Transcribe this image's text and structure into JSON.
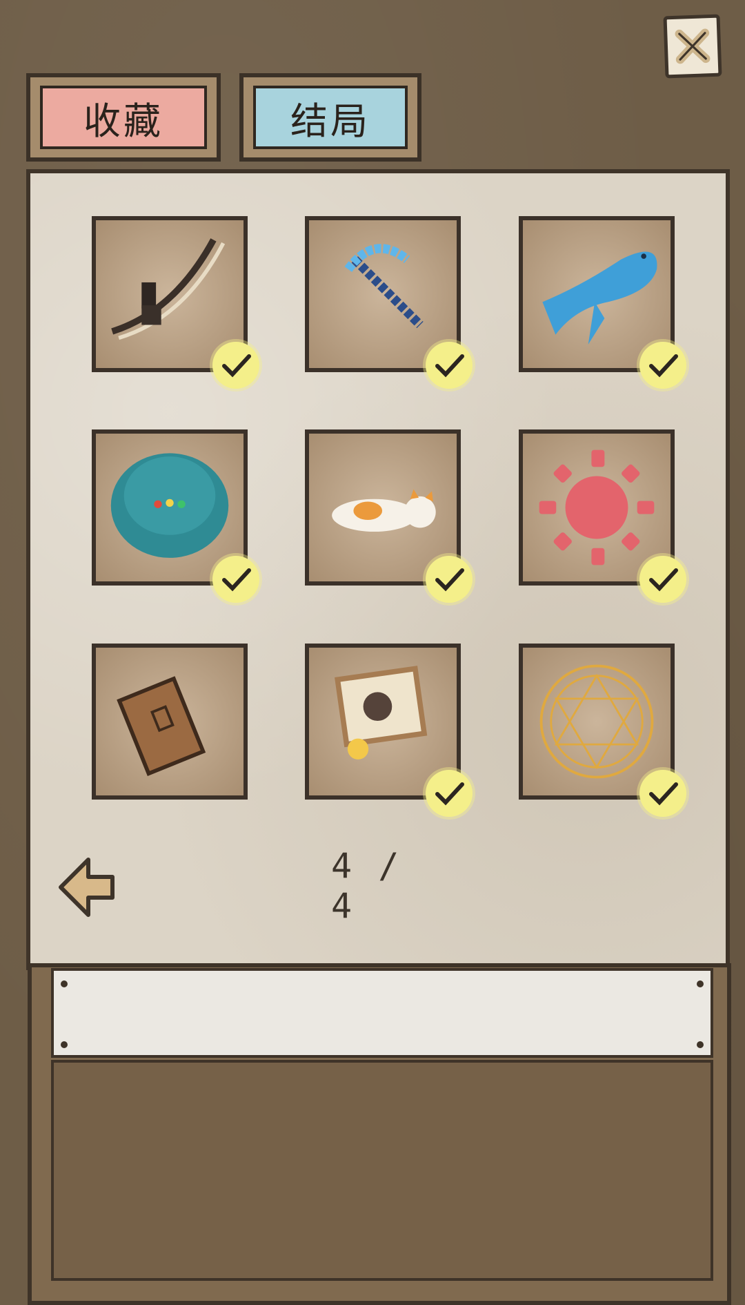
{
  "header": {
    "tabs": [
      {
        "label": "收藏",
        "selected": false,
        "color": "#ecaaa0"
      },
      {
        "label": "结局",
        "selected": true,
        "color": "#a8d3dd"
      }
    ],
    "close_icon": "close-icon"
  },
  "grid": {
    "items": [
      {
        "name": "slingshot-bow",
        "icon": "bow-icon",
        "collected": true
      },
      {
        "name": "pixel-pickaxe",
        "icon": "pickaxe-icon",
        "collected": true
      },
      {
        "name": "blue-fish",
        "icon": "fish-icon",
        "collected": true
      },
      {
        "name": "robot-vacuum",
        "icon": "robot-vacuum-icon",
        "collected": true
      },
      {
        "name": "calico-cat",
        "icon": "cat-icon",
        "collected": true
      },
      {
        "name": "red-sun",
        "icon": "sun-icon",
        "collected": true
      },
      {
        "name": "wooden-door",
        "icon": "door-icon",
        "collected": false
      },
      {
        "name": "framed-photo",
        "icon": "photo-icon",
        "collected": true
      },
      {
        "name": "magic-circle",
        "icon": "magic-circle-icon",
        "collected": true
      }
    ]
  },
  "pagination": {
    "current": "4 / 4"
  },
  "description": {
    "title": "",
    "body": ""
  },
  "colors": {
    "check": "#f4ef8a",
    "panel": "#dcd4c6",
    "frame": "#3f3429"
  }
}
